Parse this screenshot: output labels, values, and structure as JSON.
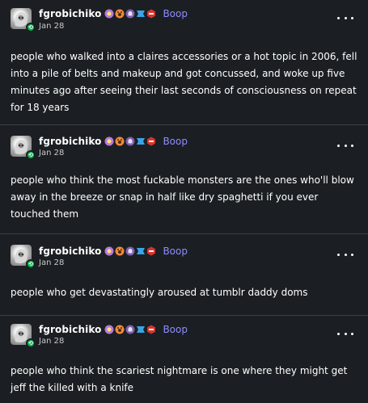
{
  "posts": [
    {
      "username": "fgrobichiko",
      "follow_label": "Boop",
      "date": "Jan 28",
      "text": "people who walked into a claires accessories or a hot topic in 2006, fell into a pile of belts and makeup and got concussed, and woke up five minutes ago after seeing their last seconds of consciousness on repeat for 18 years"
    },
    {
      "username": "fgrobichiko",
      "follow_label": "Boop",
      "date": "Jan 28",
      "text": "people who think the most fuckable monsters are the ones who'll blow away in the breeze or snap in half like dry spaghetti if you ever touched them"
    },
    {
      "username": "fgrobichiko",
      "follow_label": "Boop",
      "date": "Jan 28",
      "text": "people who get devastatingly aroused at tumblr daddy doms"
    },
    {
      "username": "fgrobichiko",
      "follow_label": "Boop",
      "date": "Jan 28",
      "text": "people who think the scariest nightmare is one where they might get jeff the killed with a knife"
    }
  ],
  "icons": {
    "badges": [
      "purple-flower-badge-icon",
      "paw-badge-icon",
      "ghost-badge-icon",
      "blue-ribbon-badge-icon",
      "red-hexagon-badge-icon"
    ],
    "menu": "more-options-icon",
    "avatar_badge": "reblog-icon"
  },
  "colors": {
    "background": "#1b1f23",
    "accent": "#8f8cff",
    "avatar_badge": "#00b84a"
  }
}
